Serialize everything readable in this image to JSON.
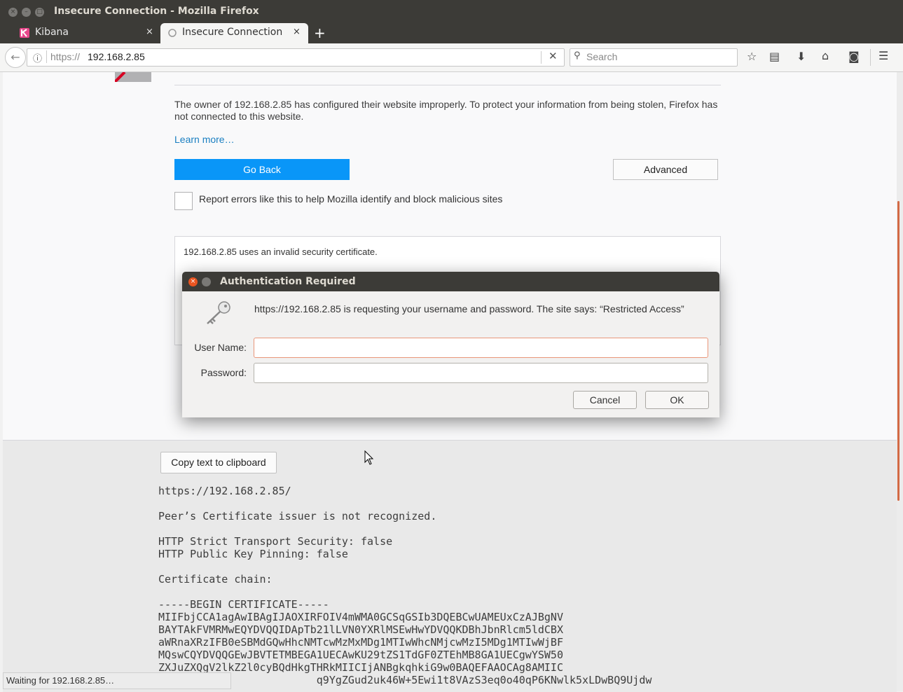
{
  "window": {
    "title": "Insecure Connection - Mozilla Firefox"
  },
  "tabs": [
    {
      "label": "Kibana",
      "close": "×",
      "active": false
    },
    {
      "label": "Insecure Connection",
      "close": "×",
      "active": true
    }
  ],
  "navbar": {
    "url_scheme": "https://",
    "url_host": "192.168.2.85",
    "search_placeholder": "Search"
  },
  "page": {
    "description": "The owner of 192.168.2.85 has configured their website improperly. To protect your information from being stolen, Firefox has not connected to this website.",
    "learn_more": "Learn more…",
    "go_back": "Go Back",
    "advanced": "Advanced",
    "report_checkbox_label": "Report errors like this to help Mozilla identify and block malicious sites",
    "report_checked": false,
    "advanced_text": "192.168.2.85 uses an invalid security certificate."
  },
  "dialog": {
    "title": "Authentication Required",
    "message": "https://192.168.2.85 is requesting your username and password. The site says: “Restricted Access”",
    "username_label": "User Name:",
    "username_value": "",
    "password_label": "Password:",
    "password_value": "",
    "cancel": "Cancel",
    "ok": "OK"
  },
  "details": {
    "copy_button": "Copy text to clipboard",
    "url": "https://192.168.2.85/",
    "issuer_msg": "Peer’s Certificate issuer is not recognized.",
    "hsts": "HTTP Strict Transport Security: false",
    "hpkp": "HTTP Public Key Pinning: false",
    "chain_label": "Certificate chain:",
    "cert_lines": [
      "-----BEGIN CERTIFICATE-----",
      "MIIFbjCCA1agAwIBAgIJAOXIRFOIV4mWMA0GCSqGSIb3DQEBCwUAMEUxCzAJBgNV",
      "BAYTAkFVMRMwEQYDVQQIDApTb21lLVN0YXRlMSEwHwYDVQQKDBhJbnRlcm5ldCBX",
      "aWRnaXRzIFB0eSBMdGQwHhcNMTcwMzMxMDg1MTIwWhcNMjcwMzI5MDg1MTIwWjBF",
      "MQswCQYDVQQGEwJBVTETMBEGA1UECAwKU29tZS1TdGF0ZTEhMB8GA1UECgwYSW50",
      "ZXJuZXQgV2lkZ2l0cyBQdHkgTHRkMIICIjANBgkqhkiG9w0BAQEFAAOCAg8AMIIC",
      "                         q9YgZGud2uk46W+5Ewi1t8VAzS3eq0o40qP6KNwlk5xLDwBQ9Ujdw"
    ]
  },
  "status": {
    "text": "Waiting for 192.168.2.85…"
  }
}
